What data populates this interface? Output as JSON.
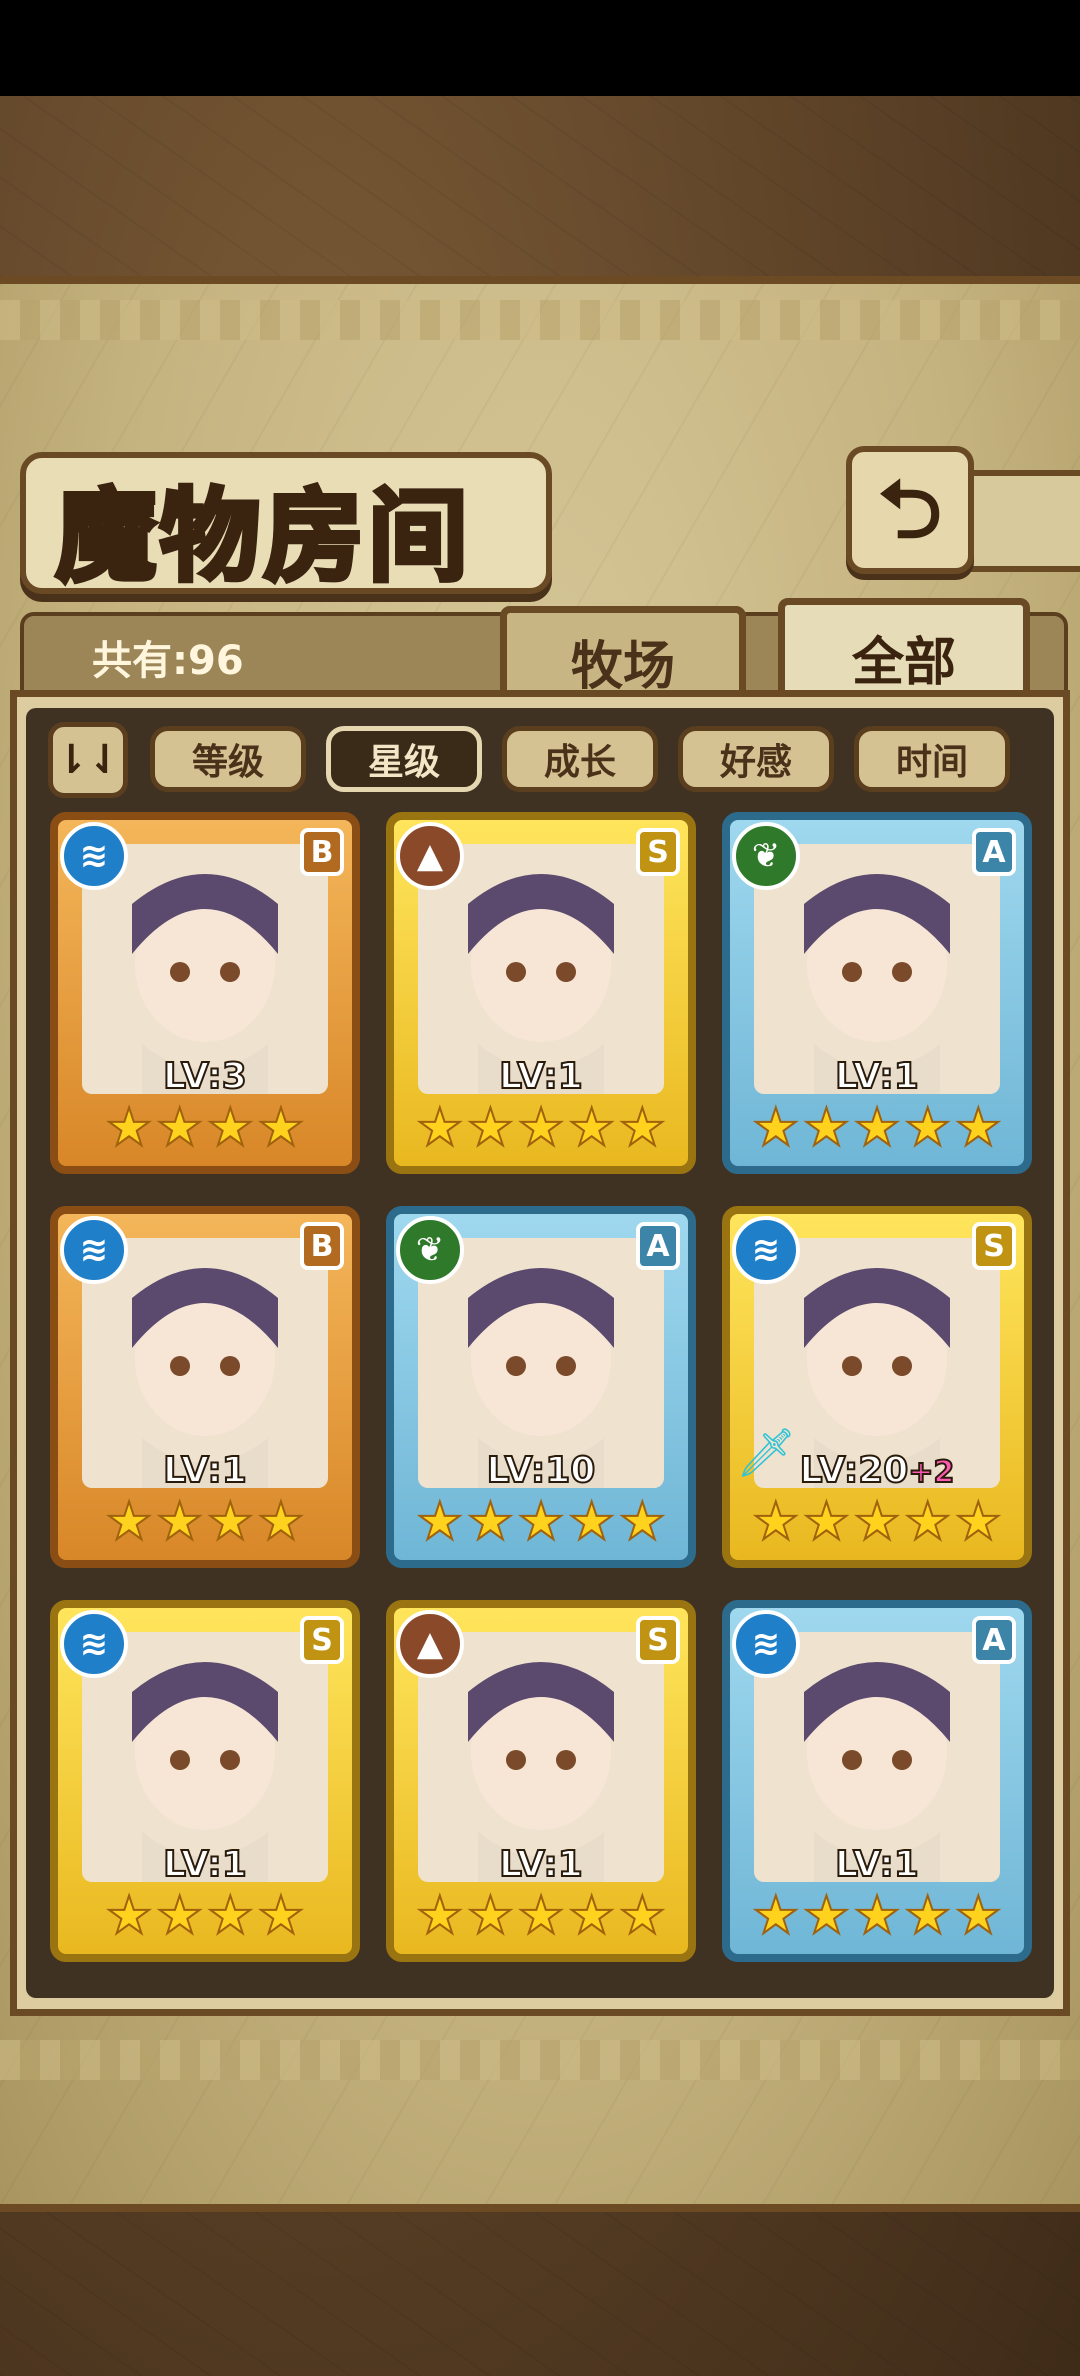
{
  "title": "魔物房间",
  "back_icon": "return-arrow-icon",
  "count_label": "共有:96",
  "tabs": [
    {
      "label": "牧场",
      "active": false
    },
    {
      "label": "全部",
      "active": true
    }
  ],
  "filters": [
    {
      "label": "等级",
      "active": false
    },
    {
      "label": "星级",
      "active": true
    },
    {
      "label": "成长",
      "active": false
    },
    {
      "label": "好感",
      "active": false
    },
    {
      "label": "时间",
      "active": false
    }
  ],
  "cards": [
    {
      "element": "water",
      "element_icon": "≋",
      "rank": "B",
      "frame": "orange",
      "level": "LV:3",
      "bonus": "",
      "stars": 4,
      "has_sword": false
    },
    {
      "element": "earth",
      "element_icon": "▲",
      "rank": "S",
      "frame": "gold",
      "level": "LV:1",
      "bonus": "",
      "stars": 5,
      "has_sword": false
    },
    {
      "element": "wood",
      "element_icon": "❦",
      "rank": "A",
      "frame": "blue",
      "level": "LV:1",
      "bonus": "",
      "stars": 5,
      "has_sword": false
    },
    {
      "element": "water",
      "element_icon": "≋",
      "rank": "B",
      "frame": "orange",
      "level": "LV:1",
      "bonus": "",
      "stars": 4,
      "has_sword": false
    },
    {
      "element": "wood",
      "element_icon": "❦",
      "rank": "A",
      "frame": "blue",
      "level": "LV:10",
      "bonus": "",
      "stars": 5,
      "has_sword": false
    },
    {
      "element": "water",
      "element_icon": "≋",
      "rank": "S",
      "frame": "gold",
      "level": "LV:20",
      "bonus": "+2",
      "stars": 5,
      "has_sword": true
    },
    {
      "element": "water",
      "element_icon": "≋",
      "rank": "S",
      "frame": "gold",
      "level": "LV:1",
      "bonus": "",
      "stars": 4,
      "has_sword": false
    },
    {
      "element": "earth",
      "element_icon": "▲",
      "rank": "S",
      "frame": "gold",
      "level": "LV:1",
      "bonus": "",
      "stars": 5,
      "has_sword": false
    },
    {
      "element": "water",
      "element_icon": "≋",
      "rank": "A",
      "frame": "blue",
      "level": "LV:1",
      "bonus": "",
      "stars": 5,
      "has_sword": false
    }
  ]
}
